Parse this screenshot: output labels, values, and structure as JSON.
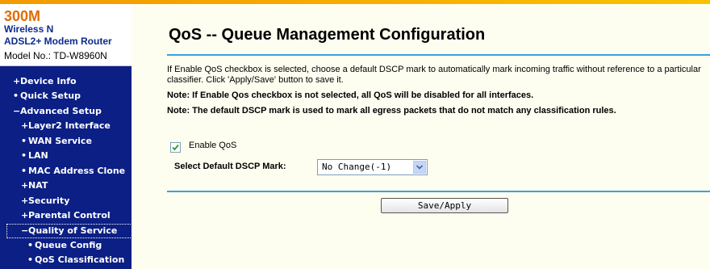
{
  "brand": {
    "model_title": "300M",
    "line1": "Wireless N",
    "line2": "ADSL2+ Modem Router",
    "model_no": "Model No.: TD-W8960N"
  },
  "sidebar": {
    "items": [
      {
        "marker": "+",
        "label": "Device Info"
      },
      {
        "marker": "•",
        "label": "Quick Setup"
      },
      {
        "marker": "−",
        "label": "Advanced Setup"
      },
      {
        "marker": "+",
        "label": "Layer2 Interface"
      },
      {
        "marker": "•",
        "label": "WAN Service"
      },
      {
        "marker": "•",
        "label": "LAN"
      },
      {
        "marker": "•",
        "label": "MAC Address Clone"
      },
      {
        "marker": "+",
        "label": "NAT"
      },
      {
        "marker": "+",
        "label": "Security"
      },
      {
        "marker": "+",
        "label": "Parental Control"
      },
      {
        "marker": "−",
        "label": "Quality of Service"
      },
      {
        "marker": "•",
        "label": "Queue Config"
      },
      {
        "marker": "•",
        "label": "QoS Classification"
      }
    ]
  },
  "main": {
    "title": "QoS -- Queue Management Configuration",
    "description": "If Enable QoS checkbox is selected, choose a default DSCP mark to automatically mark incoming traffic without reference to a particular classifier. Click 'Apply/Save' button to save it.",
    "note1": "Note: If Enable Qos checkbox is not selected, all QoS will be disabled for all interfaces.",
    "note2": "Note: The default DSCP mark is used to mark all egress packets that do not match any classification rules.",
    "enable_qos_label": "Enable QoS",
    "enable_qos_checked": true,
    "dscp_label": "Select Default DSCP Mark:",
    "dscp_value": "No Change(-1)",
    "save_button": "Save/Apply"
  },
  "colors": {
    "sidebar_bg": "#0b1f84",
    "main_bg": "#fdfef0",
    "separator": "#3aa2d8",
    "brand_accent": "#e26b00"
  }
}
